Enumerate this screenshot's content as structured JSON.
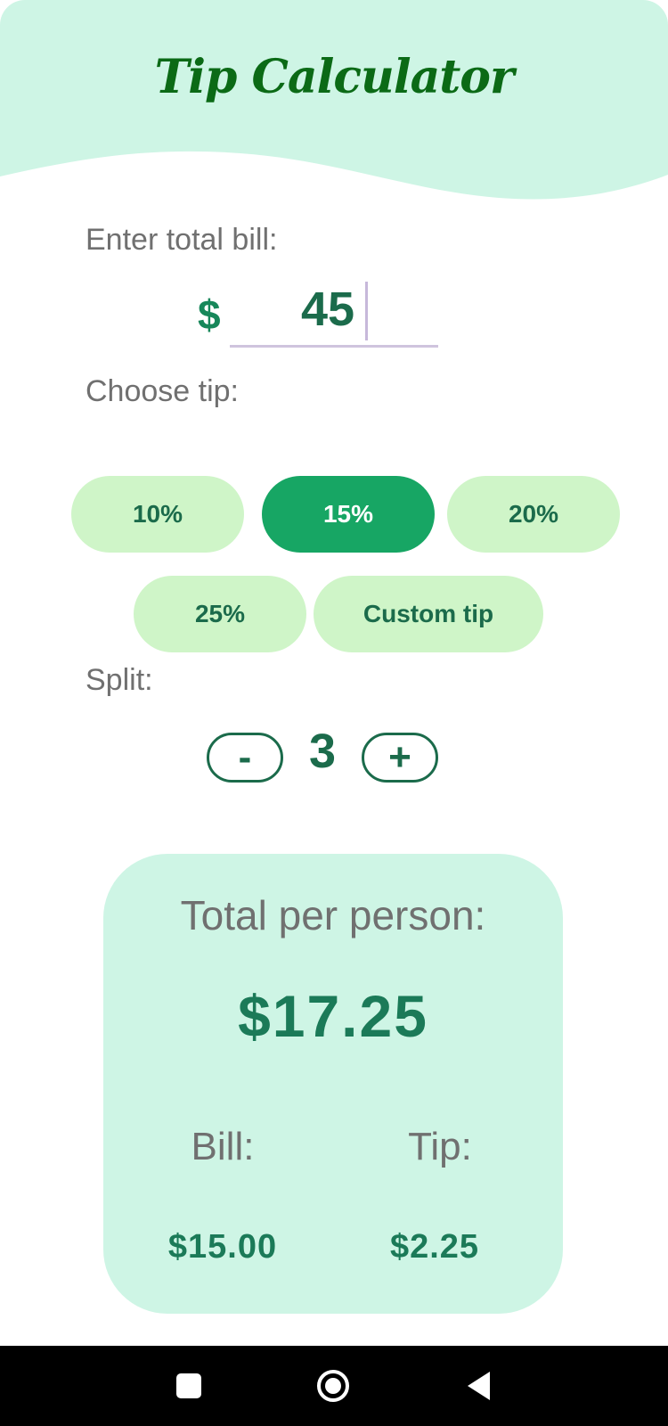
{
  "header": {
    "title": "Tip Calculator"
  },
  "bill": {
    "label": "Enter total bill:",
    "currency_symbol": "$",
    "value": "45"
  },
  "tip": {
    "label": "Choose tip:",
    "options": [
      {
        "label": "10%",
        "selected": false
      },
      {
        "label": "15%",
        "selected": true
      },
      {
        "label": "20%",
        "selected": false
      },
      {
        "label": "25%",
        "selected": false
      },
      {
        "label": "Custom tip",
        "selected": false
      }
    ]
  },
  "split": {
    "label": "Split:",
    "decrement_label": "-",
    "increment_label": "+",
    "count": "3"
  },
  "result": {
    "title": "Total per person:",
    "total": "$17.25",
    "bill_label": "Bill:",
    "bill_value": "$15.00",
    "tip_label": "Tip:",
    "tip_value": "$2.25"
  },
  "navbar": {
    "icons": [
      "recents-square-icon",
      "home-circle-icon",
      "back-triangle-icon"
    ]
  },
  "colors": {
    "header_bg": "#cef5e5",
    "title": "#0b6a16",
    "accent": "#17a664",
    "pill_bg": "#cff5c8",
    "text_green": "#1b6b4b",
    "card_bg": "#cef5e5"
  }
}
